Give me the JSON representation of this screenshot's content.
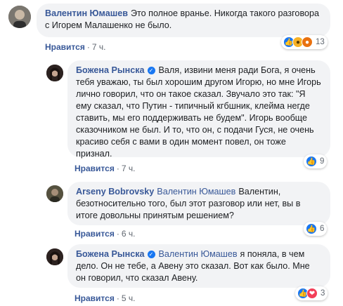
{
  "actions": {
    "like_label": "Нравится",
    "separator": "·"
  },
  "icons": {
    "like": "thumbs-up-icon",
    "wow": "wow-icon",
    "angry": "angry-icon",
    "love": "love-icon"
  },
  "colors": {
    "link": "#385898",
    "bubble": "#f2f3f5",
    "like_blue": "#1877f2"
  },
  "comments": [
    {
      "author": "Валентин Юмашев",
      "text": "Это полное вранье. Никогда такого разговора с Игорем Малашенко не было.",
      "time": "7 ч.",
      "reaction_count": "13"
    },
    {
      "author": "Божена Рынска",
      "verified": true,
      "text": "Валя, извини меня ради Бога, я очень тебя уважаю, ты был хорошим другом Игорю, но мне Игорь лично говорил, что он такое сказал. Звучало это так: \"Я ему сказал, что Путин - типичный кгбшник, клейма негде ставить, мы его поддерживать не будем\". Игорь вообще сказочником не был. И то, что он, с подачи Гуся, не очень красиво себя с вами в один момент повел, он тоже признал.",
      "time": "7 ч.",
      "reaction_count": "9"
    },
    {
      "author": "Arseny Bobrovsky",
      "mention": "Валентин Юмашев",
      "text": "Валентин, безотносительно того, был этот разговор или нет, вы в итоге довольны принятым решением?",
      "time": "6 ч.",
      "reaction_count": "6"
    },
    {
      "author": "Божена Рынска",
      "verified": true,
      "mention": "Валентин Юмашев",
      "text": "я поняла, в чем дело. Он не тебе, а Авену это сказал. Вот как было. Мне он говорил, что сказал Авену.",
      "time": "5 ч.",
      "reaction_count": "3"
    }
  ]
}
